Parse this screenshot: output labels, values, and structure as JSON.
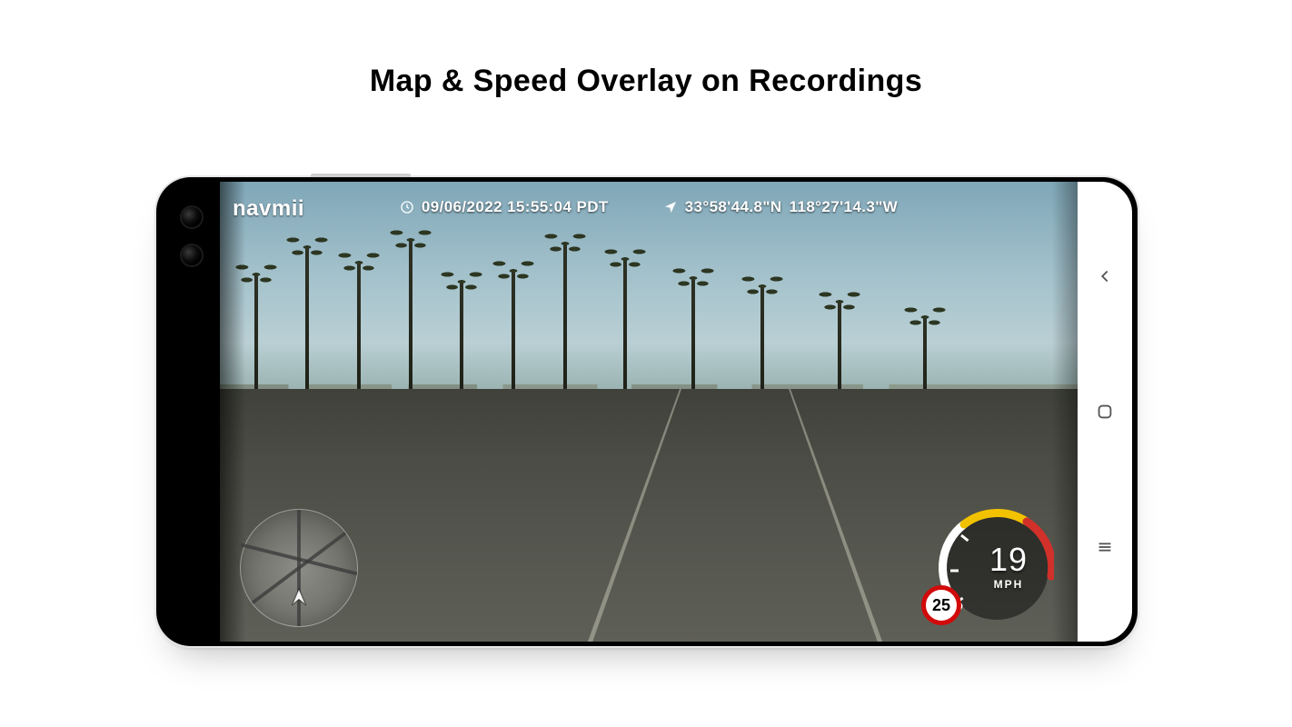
{
  "heading": "Map & Speed Overlay on Recordings",
  "overlay": {
    "brand": "navmii",
    "timestamp": "09/06/2022 15:55:04 PDT",
    "latitude": "33°58'44.8\"N",
    "longitude": "118°27'14.3\"W"
  },
  "gauge": {
    "speed": "19",
    "unit": "MPH",
    "speed_limit": "25"
  },
  "nav": {
    "back": "Back",
    "home": "Home",
    "recents": "Recents"
  }
}
